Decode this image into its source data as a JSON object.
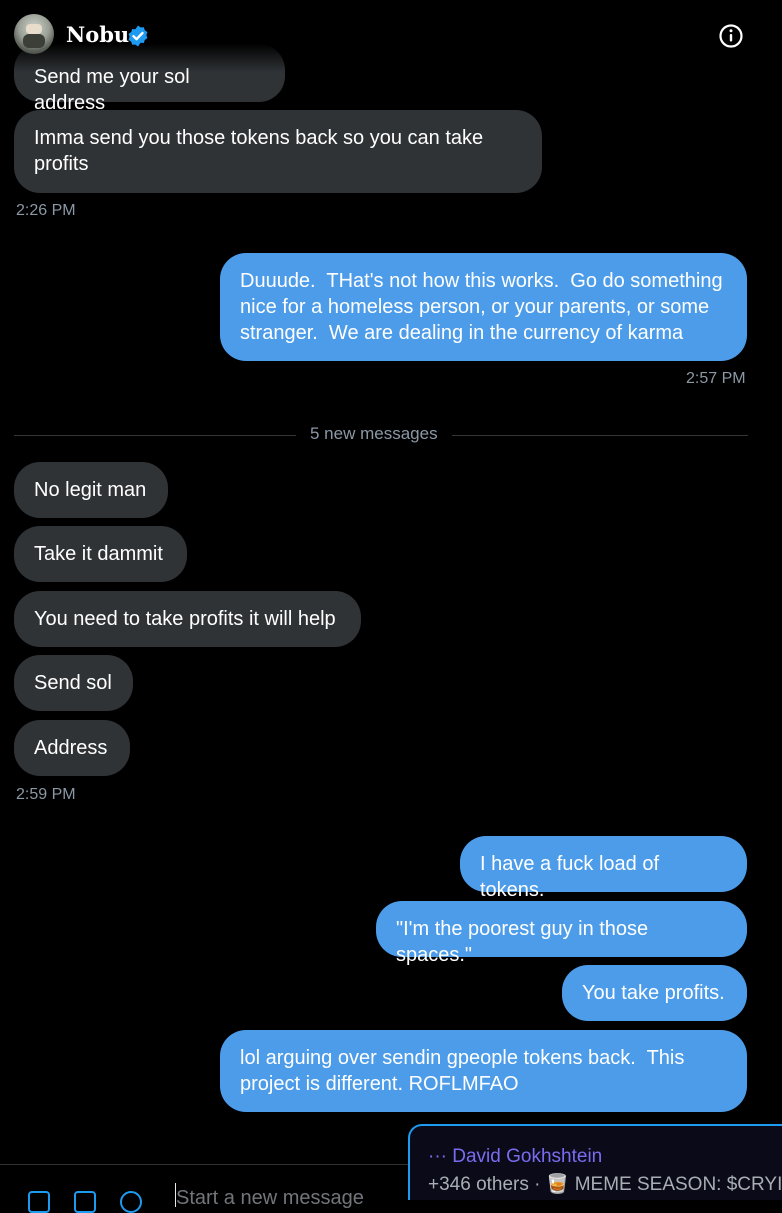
{
  "header": {
    "title": "Nobu",
    "avatar_icon": "avatar-image",
    "verified_icon": "verified-badge-icon",
    "info_icon": "info-icon"
  },
  "messages": {
    "m1": "Send me your sol address",
    "m2": "Imma send you those tokens back so you can take profits",
    "t1": "2:26 PM",
    "m3": "Duuude.  THat's not how this works.  Go do something nice for a homeless person, or your parents, or some stranger.  We are dealing in the currency of karma",
    "t2": "2:57 PM",
    "divider": "5 new messages",
    "m4": "No legit man",
    "m5": "Take it dammit",
    "m6": "You need to take profits it will help",
    "m7": "Send sol",
    "m8": "Address",
    "t3": "2:59 PM",
    "m9": "I have a fuck load of tokens.",
    "m10": "\"I'm the poorest guy in those spaces.\"",
    "m11": "You take profits.",
    "m12": "lol arguing over sendin gpeople tokens back.  This project is different. ROFLMFAO"
  },
  "composer": {
    "placeholder": "Start a new message",
    "icons": [
      "image-icon",
      "gif-icon",
      "emoji-icon"
    ]
  },
  "spaces": {
    "host": "··· David Gokhshtein",
    "info": "+346 others · 🥃 MEME SEASON: $CRYI"
  },
  "colors": {
    "incoming_bubble": "#2f3336",
    "outgoing_bubble": "#4c9ce9",
    "accent": "#1d9bf0",
    "timestamp": "#8b98a5"
  }
}
